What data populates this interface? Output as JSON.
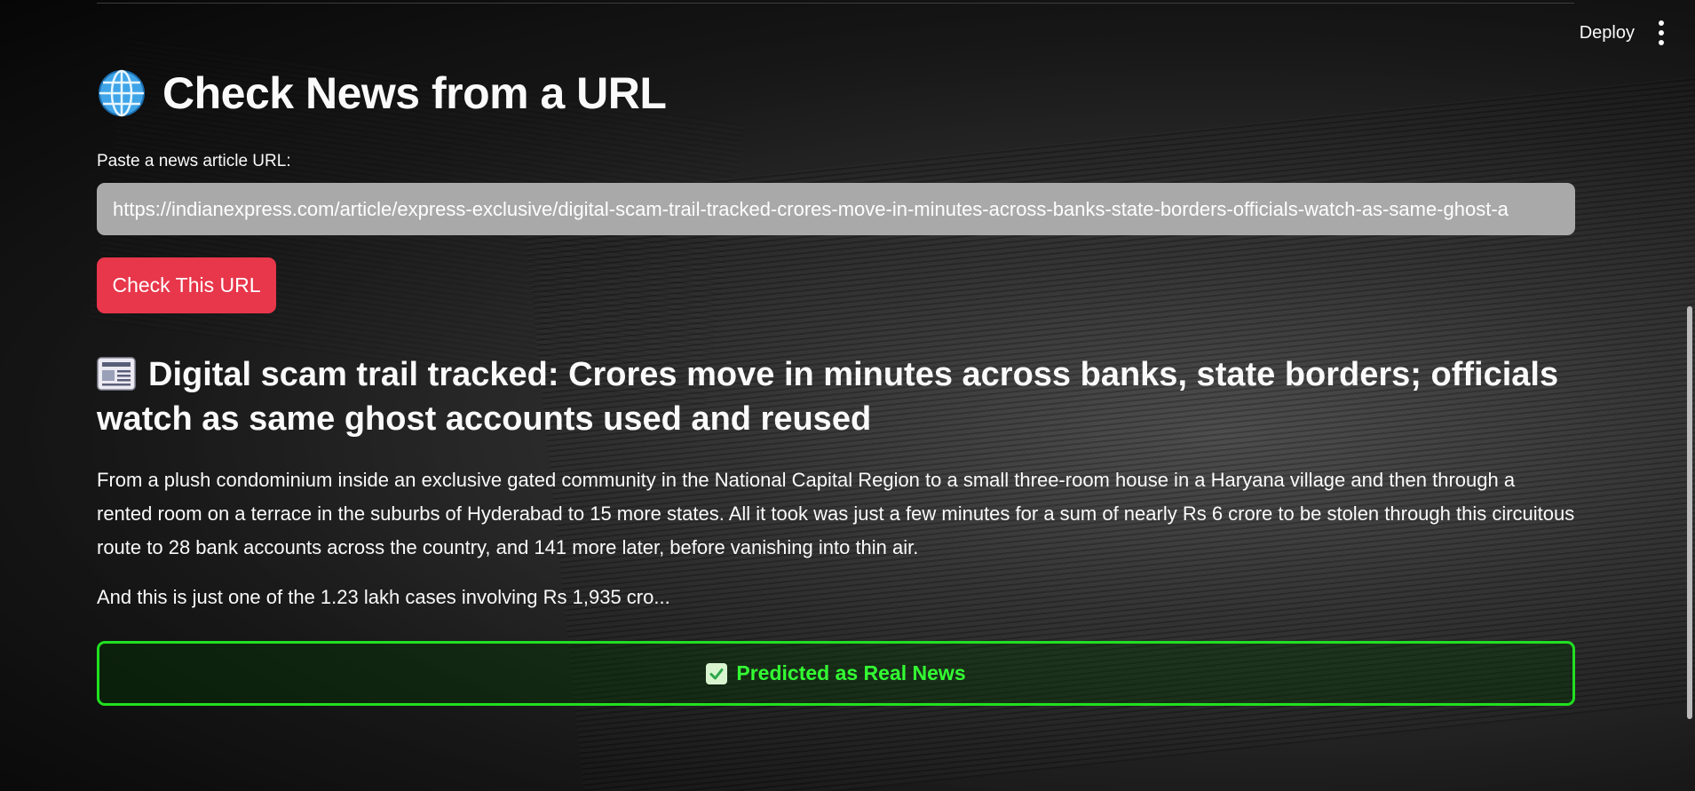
{
  "header": {
    "deploy_label": "Deploy",
    "menu_icon": "more-vertical-icon"
  },
  "page": {
    "title": "Check News from a URL",
    "title_icon": "globe-icon"
  },
  "form": {
    "url_label": "Paste a news article URL:",
    "url_value": "https://indianexpress.com/article/express-exclusive/digital-scam-trail-tracked-crores-move-in-minutes-across-banks-state-borders-officials-watch-as-same-ghost-a",
    "submit_label": "Check This URL",
    "submit_color": "#e8364a"
  },
  "article": {
    "icon": "newspaper-icon",
    "title": "Digital scam trail tracked: Crores move in minutes across banks, state borders; officials watch as same ghost accounts used and reused",
    "body": "From a plush condominium inside an exclusive gated community in the National Capital Region to a small three-room house in a Haryana village and then through a rented room on a terrace in the suburbs of Hyderabad to 15 more states. All it took was just a few minutes for a sum of nearly Rs 6 crore to be stolen through this circuitous route to 28 bank accounts across the country, and 141 more later, before vanishing into thin air.",
    "snippet": "And this is just one of the 1.23 lakh cases involving Rs 1,935 cro..."
  },
  "result": {
    "icon": "check-box-icon",
    "text": "Predicted as Real News",
    "color": "#33ff33",
    "border_color": "#21e021"
  }
}
